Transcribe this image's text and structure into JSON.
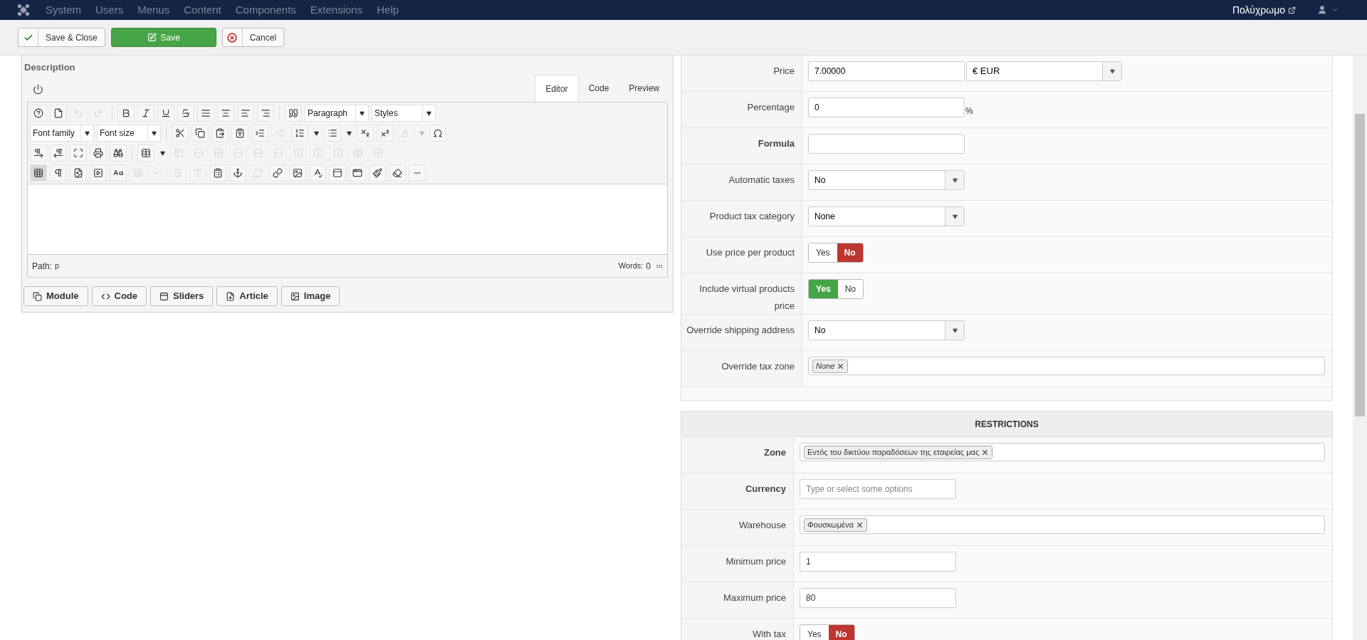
{
  "nav": {
    "menu": [
      "System",
      "Users",
      "Menus",
      "Content",
      "Components",
      "Extensions",
      "Help"
    ],
    "site_link": "Πολύχρωμο"
  },
  "actions": [
    {
      "label": "Save & Close",
      "kind": "save_close"
    },
    {
      "label": "Save",
      "kind": "save"
    },
    {
      "label": "Cancel",
      "kind": "cancel"
    }
  ],
  "description": {
    "title": "Description",
    "tabs": [
      {
        "label": "Editor",
        "selected": true
      },
      {
        "label": "Code",
        "selected": false
      },
      {
        "label": "Preview",
        "selected": false
      }
    ],
    "toolbar": [
      [
        {
          "kind": "help",
          "disabled": false
        },
        {
          "kind": "new",
          "disabled": false
        },
        {
          "kind": "undo",
          "disabled": true
        },
        {
          "kind": "redo",
          "disabled": true
        },
        {
          "kind": "sep"
        },
        {
          "kind": "bold",
          "disabled": false
        },
        {
          "kind": "italic",
          "disabled": false
        },
        {
          "kind": "underline",
          "disabled": false
        },
        {
          "kind": "strike",
          "disabled": false
        },
        {
          "kind": "justify",
          "disabled": false
        },
        {
          "kind": "center",
          "disabled": false
        },
        {
          "kind": "left",
          "disabled": false
        },
        {
          "kind": "right",
          "disabled": false
        },
        {
          "kind": "sep"
        },
        {
          "kind": "quote",
          "disabled": false
        },
        {
          "kind": "select",
          "label": "Paragraph"
        },
        {
          "kind": "select",
          "label": "Styles"
        }
      ],
      [
        {
          "kind": "select",
          "label": "Font family"
        },
        {
          "kind": "select",
          "label": "Font size"
        },
        {
          "kind": "sep"
        },
        {
          "kind": "cut",
          "disabled": false
        },
        {
          "kind": "copy",
          "disabled": false
        },
        {
          "kind": "paste",
          "disabled": false
        },
        {
          "kind": "paste_text",
          "disabled": false
        },
        {
          "kind": "indent",
          "disabled": false
        },
        {
          "kind": "outdent",
          "disabled": true
        },
        {
          "kind": "numlist",
          "disabled": false
        },
        {
          "kind": "caret",
          "disabled": false
        },
        {
          "kind": "bullist",
          "disabled": false
        },
        {
          "kind": "caret",
          "disabled": false
        },
        {
          "kind": "sub",
          "disabled": false
        },
        {
          "kind": "sup",
          "disabled": false
        },
        {
          "kind": "color",
          "disabled": true
        },
        {
          "kind": "caret",
          "disabled": true
        },
        {
          "kind": "charmap",
          "disabled": false
        }
      ],
      [
        {
          "kind": "ltr",
          "disabled": false
        },
        {
          "kind": "rtl",
          "disabled": false
        },
        {
          "kind": "fullscreen",
          "disabled": false
        },
        {
          "kind": "print",
          "disabled": false
        },
        {
          "kind": "search",
          "disabled": false
        },
        {
          "kind": "sep"
        },
        {
          "kind": "table",
          "disabled": false
        },
        {
          "kind": "caret",
          "disabled": false
        },
        {
          "kind": "table_delete",
          "disabled": true
        },
        {
          "kind": "table_row",
          "disabled": true
        },
        {
          "kind": "table_cell",
          "disabled": true
        },
        {
          "kind": "table_row",
          "disabled": true
        },
        {
          "kind": "table_row",
          "disabled": true
        },
        {
          "kind": "table_row",
          "disabled": true
        },
        {
          "kind": "table_col",
          "disabled": true
        },
        {
          "kind": "table_col",
          "disabled": true
        },
        {
          "kind": "table_col",
          "disabled": true
        },
        {
          "kind": "table",
          "disabled": true
        },
        {
          "kind": "table_cell",
          "disabled": true
        }
      ],
      [
        {
          "kind": "visualaid",
          "disabled": false,
          "pressed": true
        },
        {
          "kind": "pilcrow",
          "disabled": false
        },
        {
          "kind": "file_image",
          "disabled": false
        },
        {
          "kind": "media",
          "disabled": false
        },
        {
          "kind": "font",
          "disabled": false
        },
        {
          "kind": "quote",
          "disabled": true
        },
        {
          "kind": "abbr",
          "disabled": true
        },
        {
          "kind": "strike",
          "disabled": true
        },
        {
          "kind": "letter",
          "disabled": true
        },
        {
          "kind": "template",
          "disabled": false
        },
        {
          "kind": "anchor",
          "disabled": false
        },
        {
          "kind": "unlink",
          "disabled": true
        },
        {
          "kind": "link",
          "disabled": false
        },
        {
          "kind": "image",
          "disabled": false
        },
        {
          "kind": "spellcheck",
          "disabled": false
        },
        {
          "kind": "hr_box",
          "disabled": false
        },
        {
          "kind": "preview",
          "disabled": false
        },
        {
          "kind": "brush",
          "disabled": false
        },
        {
          "kind": "eraser",
          "disabled": false
        },
        {
          "kind": "hr",
          "disabled": false
        }
      ]
    ],
    "path_label": "Path:",
    "path": "p",
    "words_label": "Words:",
    "words": "0",
    "buttons": [
      {
        "label": "Module",
        "kind": "module"
      },
      {
        "label": "Code",
        "kind": "code"
      },
      {
        "label": "Sliders",
        "kind": "sliders"
      },
      {
        "label": "Article",
        "kind": "article"
      },
      {
        "label": "Image",
        "kind": "image"
      }
    ]
  },
  "price_form": [
    {
      "label": "Price",
      "bold": false,
      "kind": "currency",
      "value": "7.00000",
      "currency": "€ EUR"
    },
    {
      "label": "Percentage",
      "bold": false,
      "kind": "percent",
      "value": "0",
      "suffix": "%"
    },
    {
      "label": "Formula",
      "bold": true,
      "kind": "text"
    },
    {
      "label": "Automatic taxes",
      "bold": false,
      "kind": "select",
      "value": "No"
    },
    {
      "label": "Product tax category",
      "bold": false,
      "kind": "select",
      "value": "None"
    },
    {
      "label": "Use price per product",
      "bold": false,
      "kind": "toggle",
      "options": [
        {
          "label": "Yes",
          "selected": false
        },
        {
          "label": "No",
          "selected": true
        }
      ]
    },
    {
      "label": "Include virtual products price",
      "bold": false,
      "kind": "toggle",
      "options": [
        {
          "label": "Yes",
          "selected": true
        },
        {
          "label": "No",
          "selected": false
        }
      ]
    },
    {
      "label": "Override shipping address",
      "bold": false,
      "kind": "select",
      "value": "No"
    },
    {
      "label": "Override tax zone",
      "bold": false,
      "kind": "tags",
      "tags": [
        "None"
      ],
      "italic_tags": true
    }
  ],
  "restrictions": {
    "title": "RESTRICTIONS",
    "rows": [
      {
        "label": "Zone",
        "bold": true,
        "kind": "tags",
        "tags": [
          "Εντός του δικτύου παραδόσεων της εταιρείας μας"
        ],
        "italic_tags": false
      },
      {
        "label": "Currency",
        "bold": true,
        "kind": "text",
        "placeholder": "Type or select some options"
      },
      {
        "label": "Warehouse",
        "bold": false,
        "kind": "tags",
        "tags": [
          "Φουσκωμένα"
        ],
        "italic_tags": false
      },
      {
        "label": "Minimum price",
        "bold": false,
        "kind": "text",
        "value": "1"
      },
      {
        "label": "Maximum price",
        "bold": false,
        "kind": "text",
        "value": "80"
      },
      {
        "label": "With tax",
        "bold": false,
        "kind": "toggle",
        "options": [
          {
            "label": "Yes",
            "selected": false
          },
          {
            "label": "No",
            "selected": true
          }
        ]
      }
    ]
  }
}
